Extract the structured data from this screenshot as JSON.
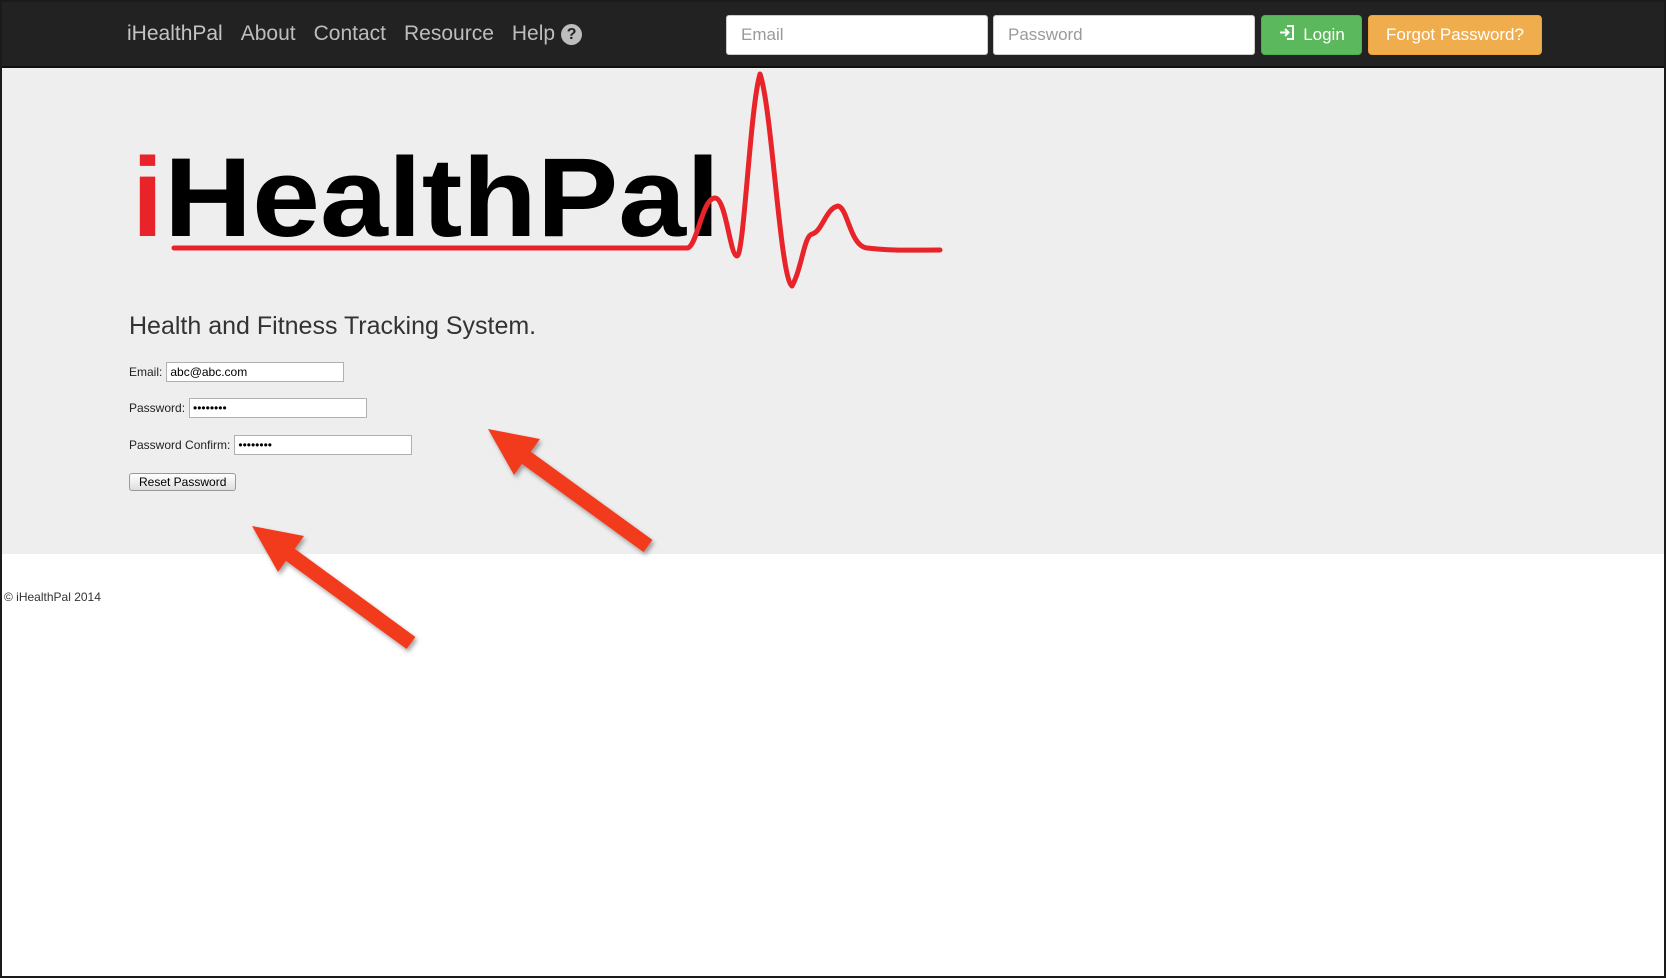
{
  "navbar": {
    "brand": "iHealthPal",
    "links": [
      "About",
      "Contact",
      "Resource",
      "Help"
    ],
    "help_icon": "question-circle-icon",
    "email_placeholder": "Email",
    "password_placeholder": "Password",
    "login_label": "Login",
    "login_icon": "sign-in-icon",
    "forgot_label": "Forgot Password?"
  },
  "hero": {
    "logo_text_i": "i",
    "logo_text_rest": "HealthPal",
    "tagline": "Health and Fitness Tracking System."
  },
  "form": {
    "email_label": "Email:",
    "email_value": "abc@abc.com",
    "password_label": "Password:",
    "password_value": "••••••••",
    "confirm_label": "Password Confirm:",
    "confirm_value": "••••••••",
    "reset_button": "Reset Password"
  },
  "footer": {
    "text": "© iHealthPal 2014"
  },
  "colors": {
    "navbar_bg": "#222222",
    "hero_bg": "#eeeeee",
    "login_green": "#5cb85c",
    "forgot_orange": "#f0ad4e",
    "logo_red": "#e8232a",
    "arrow_red": "#f23a1e"
  }
}
